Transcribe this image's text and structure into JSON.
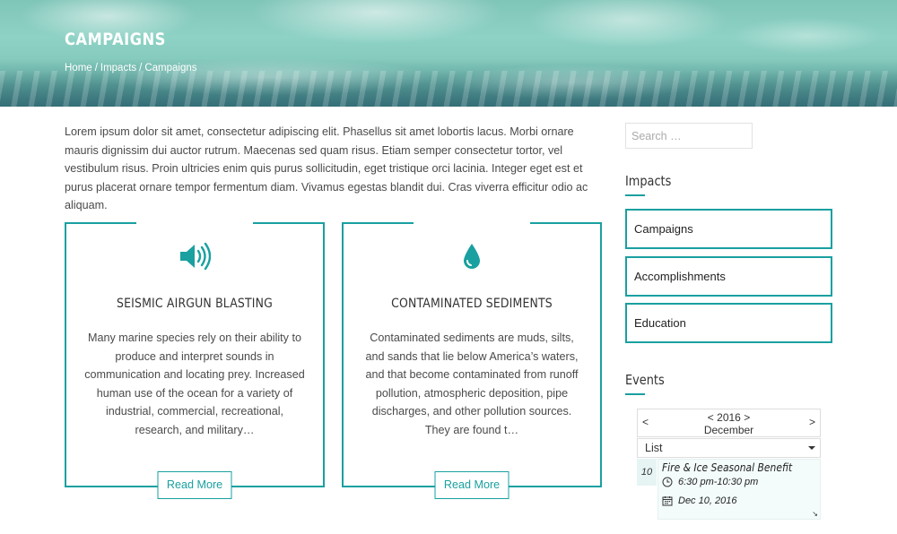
{
  "hero": {
    "title": "CAMPAIGNS",
    "breadcrumb": [
      "Home",
      "Impacts",
      "Campaigns"
    ],
    "separator": "/"
  },
  "intro": "Lorem ipsum dolor sit amet, consectetur adipiscing elit. Phasellus sit amet lobortis lacus. Morbi ornare mauris dignissim dui auctor rutrum. Maecenas sed quam risus. Etiam semper consectetur tortor, vel vestibulum risus. Proin ultricies enim quis purus sollicitudin, eget tristique orci lacinia. Integer eget est et purus placerat ornare tempor fermentum diam. Vivamus egestas blandit dui. Cras viverra efficitur odio ac aliquam.",
  "cards": [
    {
      "icon": "speaker-icon",
      "title": "SEISMIC AIRGUN BLASTING",
      "text": "Many marine species rely on their ability to produce and interpret sounds in communication and locating prey. Increased human use of the ocean for a variety of industrial, commercial, recreational, research, and military…",
      "button": "Read More"
    },
    {
      "icon": "droplet-icon",
      "title": "CONTAMINATED SEDIMENTS",
      "text": "Contaminated sediments are muds, silts, and sands that lie below America’s waters, and that become contaminated from runoff pollution, atmospheric deposition, pipe discharges, and other pollution sources. They are found t…",
      "button": "Read More"
    }
  ],
  "sidebar": {
    "search_placeholder": "Search …",
    "impacts_title": "Impacts",
    "impacts_links": [
      "Campaigns",
      "Accomplishments",
      "Education"
    ],
    "events_title": "Events"
  },
  "calendar": {
    "prev": "<",
    "next": ">",
    "year_prev": "<",
    "year": "2016",
    "year_next": ">",
    "month": "December",
    "view": "List",
    "day": "10",
    "event": {
      "title": "Fire & Ice Seasonal Benefit",
      "time": "6:30 pm-10:30 pm",
      "date": "Dec 10, 2016"
    }
  },
  "colors": {
    "accent": "#1aa0a0",
    "text": "#4a4a4a",
    "heading": "#333333"
  }
}
